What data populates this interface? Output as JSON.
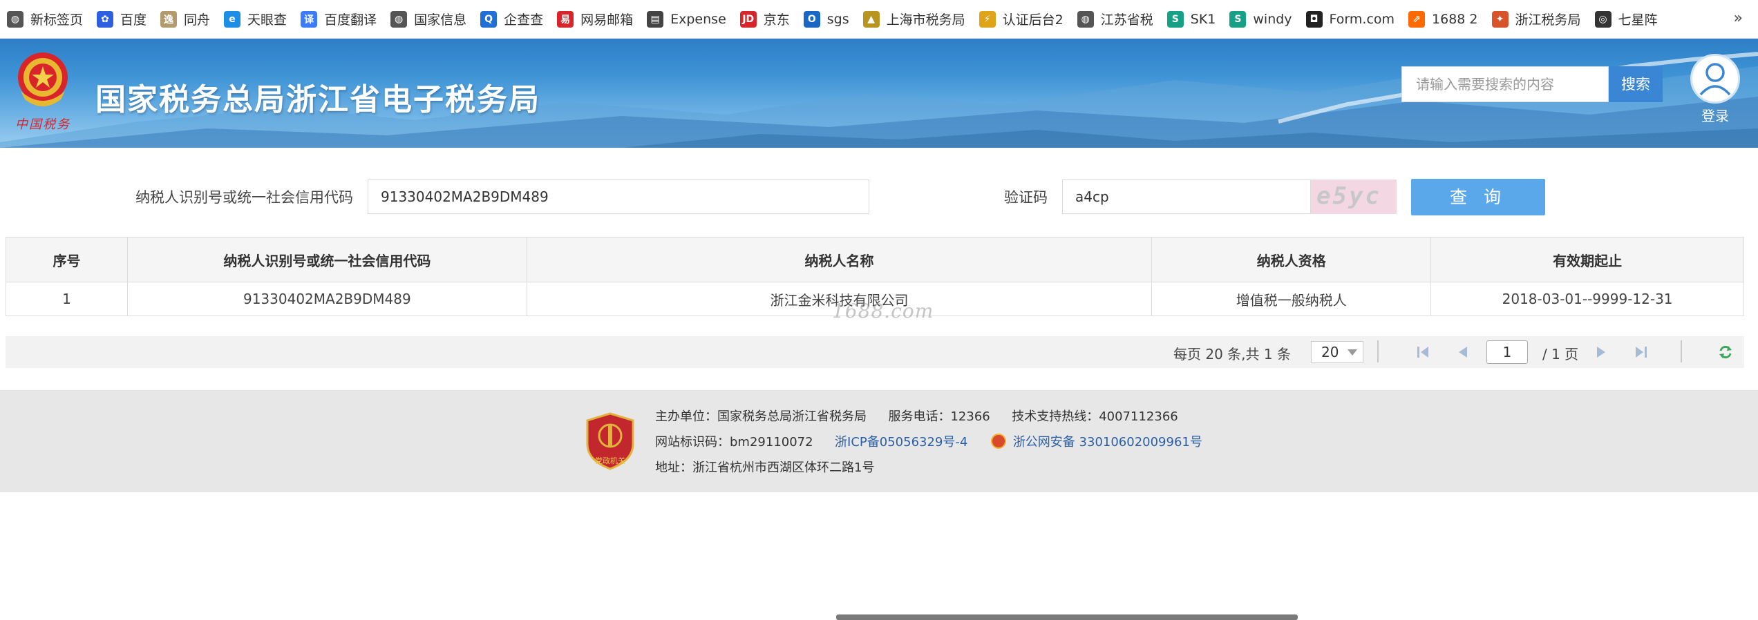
{
  "bookmarks": {
    "items": [
      {
        "label": "新标签页",
        "icon": "globe-icon",
        "color": "#555555",
        "glyph": "◍"
      },
      {
        "label": "百度",
        "icon": "baidu-paw-icon",
        "color": "#2d5fe0",
        "glyph": "✿"
      },
      {
        "label": "同舟",
        "icon": "tongzhou-icon",
        "color": "#b39a6c",
        "glyph": "逸"
      },
      {
        "label": "天眼查",
        "icon": "tianyancha-icon",
        "color": "#1d8ee6",
        "glyph": "e"
      },
      {
        "label": "百度翻译",
        "icon": "translate-icon",
        "color": "#3a7bff",
        "glyph": "译"
      },
      {
        "label": "国家信息",
        "icon": "globe-icon",
        "color": "#555555",
        "glyph": "◍"
      },
      {
        "label": "企查查",
        "icon": "qichacha-icon",
        "color": "#1f6fd6",
        "glyph": "Q"
      },
      {
        "label": "网易邮箱",
        "icon": "netease-mail-icon",
        "color": "#d6252b",
        "glyph": "易"
      },
      {
        "label": "Expense",
        "icon": "document-icon",
        "color": "#444444",
        "glyph": "▤"
      },
      {
        "label": "京东",
        "icon": "jd-icon",
        "color": "#d7252a",
        "glyph": "JD"
      },
      {
        "label": "sgs",
        "icon": "outlook-icon",
        "color": "#1a66c4",
        "glyph": "O"
      },
      {
        "label": "上海市税务局",
        "icon": "shanghai-tax-icon",
        "color": "#b8951f",
        "glyph": "▲"
      },
      {
        "label": "认证后台2",
        "icon": "verify-icon",
        "color": "#e0a419",
        "glyph": "⚡"
      },
      {
        "label": "江苏省税",
        "icon": "globe-icon",
        "color": "#555555",
        "glyph": "◍"
      },
      {
        "label": "SK1",
        "icon": "sk1-icon",
        "color": "#16a085",
        "glyph": "S"
      },
      {
        "label": "windy",
        "icon": "windy-icon",
        "color": "#16a085",
        "glyph": "S"
      },
      {
        "label": "Form.com",
        "icon": "form-icon",
        "color": "#222222",
        "glyph": "◘"
      },
      {
        "label": "1688 2",
        "icon": "1688-icon",
        "color": "#ff6a00",
        "glyph": "⇗"
      },
      {
        "label": "浙江税务局",
        "icon": "zhejiang-tax-icon",
        "color": "#d9532a",
        "glyph": "✦"
      },
      {
        "label": "七星阵",
        "icon": "spiral-icon",
        "color": "#333333",
        "glyph": "◎"
      }
    ],
    "more": "»"
  },
  "header": {
    "title": "国家税务总局浙江省电子税务局",
    "emblem_script": "中国税务",
    "search_placeholder": "请输入需要搜索的内容",
    "search_button": "搜索",
    "login_label": "登录"
  },
  "query": {
    "tax_id_label": "纳税人识别号或统一社会信用代码",
    "tax_id_value": "91330402MA2B9DM489",
    "captcha_label": "验证码",
    "captcha_value": "a4cp",
    "captcha_image_text": "e5yc",
    "submit_label": "查 询"
  },
  "table": {
    "headers": [
      "序号",
      "纳税人识别号或统一社会信用代码",
      "纳税人名称",
      "纳税人资格",
      "有效期起止"
    ],
    "rows": [
      [
        "1",
        "91330402MA2B9DM489",
        "浙江金米科技有限公司",
        "增值税一般纳税人",
        "2018-03-01--9999-12-31"
      ]
    ],
    "watermark": "1688.com"
  },
  "pager": {
    "summary": "每页 20 条,共 1 条",
    "page_size": "20",
    "current_page": "1",
    "total_pages": "/ 1 页"
  },
  "footer": {
    "organizer": "主办单位：国家税务总局浙江省税务局",
    "service_phone": "服务电话：12366",
    "support_hotline": "技术支持热线：4007112366",
    "site_code": "网站标识码：bm29110072",
    "icp": "浙ICP备05056329号-4",
    "police_record": "浙公网安备 33010602009961号",
    "address": "地址：浙江省杭州市西湖区体环二路1号",
    "badge_text": "党政机关"
  },
  "colors": {
    "banner_blue": "#3f94d6",
    "query_button": "#5aa7ea",
    "search_button": "#3a86d4",
    "link": "#2a5fa8"
  }
}
